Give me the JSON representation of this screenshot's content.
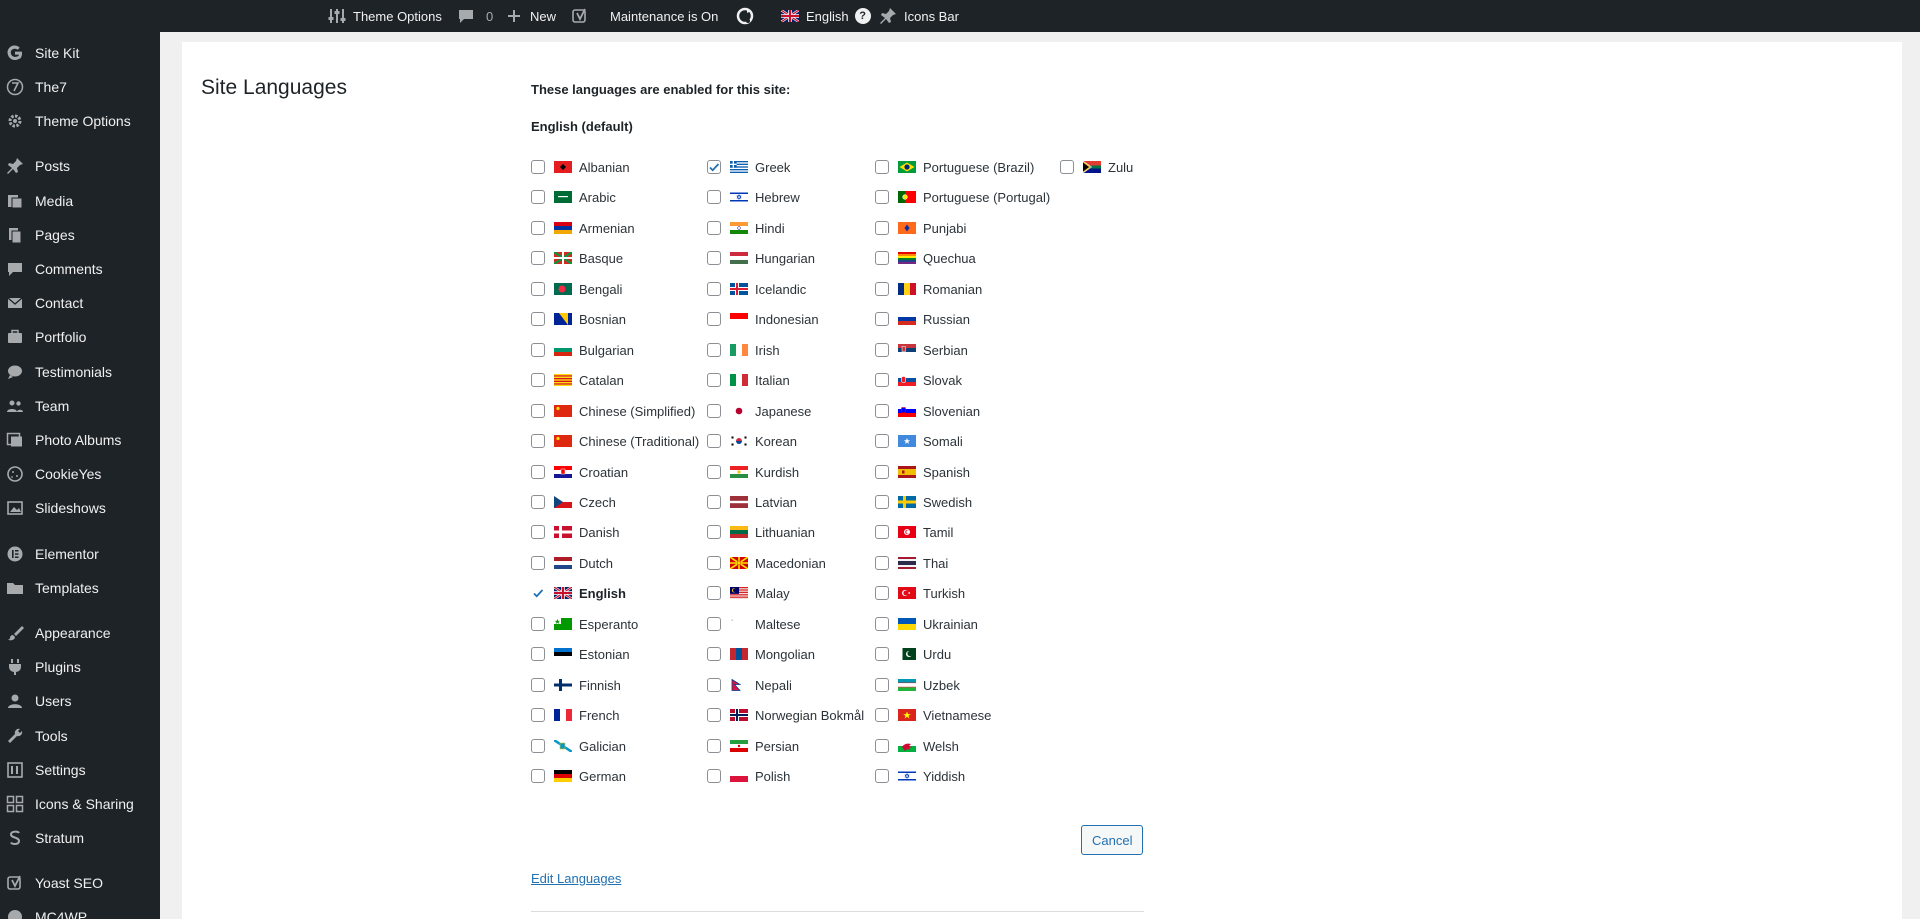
{
  "admin_bar": {
    "items": [
      {
        "label": "Theme Options",
        "icon": "sliders-icon"
      },
      {
        "label": "",
        "count": "0",
        "icon": "comment-icon"
      },
      {
        "label": "New",
        "icon": "plus-icon"
      },
      {
        "label": "",
        "icon": "yoast-icon"
      },
      {
        "label": "Maintenance is On",
        "icon": ""
      },
      {
        "label": "",
        "icon": "cycle-icon"
      },
      {
        "label": "English",
        "icon": "uk-flag-icon"
      },
      {
        "label": "Icons Bar",
        "icon": "pin-icon"
      }
    ]
  },
  "sidebar": {
    "items": [
      {
        "label": "Site Kit",
        "icon": "google-icon"
      },
      {
        "label": "The7",
        "icon": "seven-icon"
      },
      {
        "label": "Theme Options",
        "icon": "gear-icon"
      },
      {
        "label": "Posts",
        "icon": "pin-icon"
      },
      {
        "label": "Media",
        "icon": "media-icon"
      },
      {
        "label": "Pages",
        "icon": "pages-icon"
      },
      {
        "label": "Comments",
        "icon": "comment-icon"
      },
      {
        "label": "Contact",
        "icon": "mail-icon"
      },
      {
        "label": "Portfolio",
        "icon": "portfolio-icon"
      },
      {
        "label": "Testimonials",
        "icon": "testimonial-icon"
      },
      {
        "label": "Team",
        "icon": "team-icon"
      },
      {
        "label": "Photo Albums",
        "icon": "album-icon"
      },
      {
        "label": "CookieYes",
        "icon": "cookie-icon"
      },
      {
        "label": "Slideshows",
        "icon": "slides-icon"
      },
      {
        "label": "Elementor",
        "icon": "elementor-icon"
      },
      {
        "label": "Templates",
        "icon": "folder-icon"
      },
      {
        "label": "Appearance",
        "icon": "brush-icon"
      },
      {
        "label": "Plugins",
        "icon": "plugin-icon"
      },
      {
        "label": "Users",
        "icon": "user-icon"
      },
      {
        "label": "Tools",
        "icon": "wrench-icon"
      },
      {
        "label": "Settings",
        "icon": "settings-icon"
      },
      {
        "label": "Icons & Sharing",
        "icon": "share-icon"
      },
      {
        "label": "Stratum",
        "icon": "stratum-icon"
      },
      {
        "label": "Yoast SEO",
        "icon": "yoast-icon"
      },
      {
        "label": "MC4WP",
        "icon": "mc4wp-icon"
      }
    ]
  },
  "main": {
    "section_title": "Site Languages",
    "intro": "These languages are enabled for this site:",
    "default_language": "English (default)",
    "columns": [
      [
        {
          "name": "Albanian",
          "checked": false
        },
        {
          "name": "Arabic",
          "checked": false
        },
        {
          "name": "Armenian",
          "checked": false
        },
        {
          "name": "Basque",
          "checked": false
        },
        {
          "name": "Bengali",
          "checked": false
        },
        {
          "name": "Bosnian",
          "checked": false
        },
        {
          "name": "Bulgarian",
          "checked": false
        },
        {
          "name": "Catalan",
          "checked": false
        },
        {
          "name": "Chinese (Simplified)",
          "checked": false
        },
        {
          "name": "Chinese (Traditional)",
          "checked": false
        },
        {
          "name": "Croatian",
          "checked": false
        },
        {
          "name": "Czech",
          "checked": false
        },
        {
          "name": "Danish",
          "checked": false
        },
        {
          "name": "Dutch",
          "checked": false
        },
        {
          "name": "English",
          "checked": true,
          "default": true
        },
        {
          "name": "Esperanto",
          "checked": false
        },
        {
          "name": "Estonian",
          "checked": false
        },
        {
          "name": "Finnish",
          "checked": false
        },
        {
          "name": "French",
          "checked": false
        },
        {
          "name": "Galician",
          "checked": false
        },
        {
          "name": "German",
          "checked": false
        }
      ],
      [
        {
          "name": "Greek",
          "checked": true
        },
        {
          "name": "Hebrew",
          "checked": false
        },
        {
          "name": "Hindi",
          "checked": false
        },
        {
          "name": "Hungarian",
          "checked": false
        },
        {
          "name": "Icelandic",
          "checked": false
        },
        {
          "name": "Indonesian",
          "checked": false
        },
        {
          "name": "Irish",
          "checked": false
        },
        {
          "name": "Italian",
          "checked": false
        },
        {
          "name": "Japanese",
          "checked": false
        },
        {
          "name": "Korean",
          "checked": false
        },
        {
          "name": "Kurdish",
          "checked": false
        },
        {
          "name": "Latvian",
          "checked": false
        },
        {
          "name": "Lithuanian",
          "checked": false
        },
        {
          "name": "Macedonian",
          "checked": false
        },
        {
          "name": "Malay",
          "checked": false
        },
        {
          "name": "Maltese",
          "checked": false
        },
        {
          "name": "Mongolian",
          "checked": false
        },
        {
          "name": "Nepali",
          "checked": false
        },
        {
          "name": "Norwegian Bokmål",
          "checked": false
        },
        {
          "name": "Persian",
          "checked": false
        },
        {
          "name": "Polish",
          "checked": false
        }
      ],
      [
        {
          "name": "Portuguese (Brazil)",
          "checked": false
        },
        {
          "name": "Portuguese (Portugal)",
          "checked": false
        },
        {
          "name": "Punjabi",
          "checked": false
        },
        {
          "name": "Quechua",
          "checked": false
        },
        {
          "name": "Romanian",
          "checked": false
        },
        {
          "name": "Russian",
          "checked": false
        },
        {
          "name": "Serbian",
          "checked": false
        },
        {
          "name": "Slovak",
          "checked": false
        },
        {
          "name": "Slovenian",
          "checked": false
        },
        {
          "name": "Somali",
          "checked": false
        },
        {
          "name": "Spanish",
          "checked": false
        },
        {
          "name": "Swedish",
          "checked": false
        },
        {
          "name": "Tamil",
          "checked": false
        },
        {
          "name": "Thai",
          "checked": false
        },
        {
          "name": "Turkish",
          "checked": false
        },
        {
          "name": "Ukrainian",
          "checked": false
        },
        {
          "name": "Urdu",
          "checked": false
        },
        {
          "name": "Uzbek",
          "checked": false
        },
        {
          "name": "Vietnamese",
          "checked": false
        },
        {
          "name": "Welsh",
          "checked": false
        },
        {
          "name": "Yiddish",
          "checked": false
        }
      ],
      [
        {
          "name": "Zulu",
          "checked": false
        }
      ]
    ],
    "cancel_label": "Cancel",
    "edit_link": "Edit Languages"
  },
  "colors": {
    "admin_bg": "#1d2327",
    "link": "#2271b1",
    "check": "#2271b1"
  }
}
